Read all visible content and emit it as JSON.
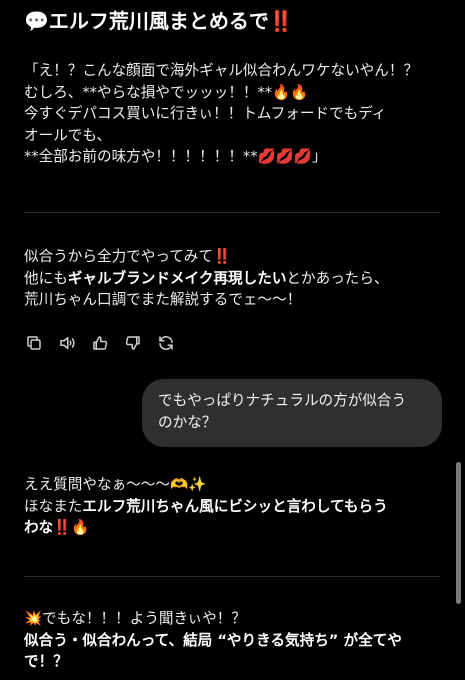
{
  "heading": {
    "icon": "💬",
    "text": "エルフ荒川風まとめるで",
    "emoji_end": "‼️"
  },
  "quote": {
    "l1": "「え！？こんな顔面で海外ギャル似合わんワケないやん！？",
    "l2_a": "むしろ、**やらな損やでッッッ！！**",
    "l2_e1": "🔥",
    "l2_e2": "🔥",
    "l3": "今すぐデパコス買いに行きぃ！！トムフォードでもディ",
    "l4": "オールでも、",
    "l5_a": "**全部お前の味方や！！！！！！**",
    "l5_e1": "💋",
    "l5_e2": "💋",
    "l5_e3": "💋",
    "l5_end": "」"
  },
  "advice": {
    "l1_a": "似合うから全力でやってみて",
    "l1_e": "‼️",
    "l2_a": "他にも",
    "l2_b": "ギャルブランドメイク再現したい",
    "l2_c": "とかあったら、",
    "l3": "荒川ちゃん口調でまた解説するでェ〜〜！"
  },
  "actions": [
    "copy-icon",
    "speaker-icon",
    "thumbs-up-icon",
    "thumbs-down-icon",
    "regenerate-icon"
  ],
  "user_message": {
    "l1": "でもやっぱりナチュラルの方が似合う",
    "l2": "のかな？"
  },
  "reply": {
    "l1_a": "ええ質問やなぁ〜〜〜",
    "l1_e1": "🫶",
    "l1_e2": "✨",
    "l2_a": "ほなまた",
    "l2_b": "エルフ荒川ちゃん風にビシッと言わしてもらう",
    "l3_b": "わな",
    "l3_e1": "‼️",
    "l3_e2": "🔥"
  },
  "reply2": {
    "l1_e": "💥",
    "l1_a": "でもな！！！よう聞きぃや！？",
    "l2": "似合う・似合わんって、結局 “やりきる気持ち” が全てや",
    "l3": "で！？"
  }
}
